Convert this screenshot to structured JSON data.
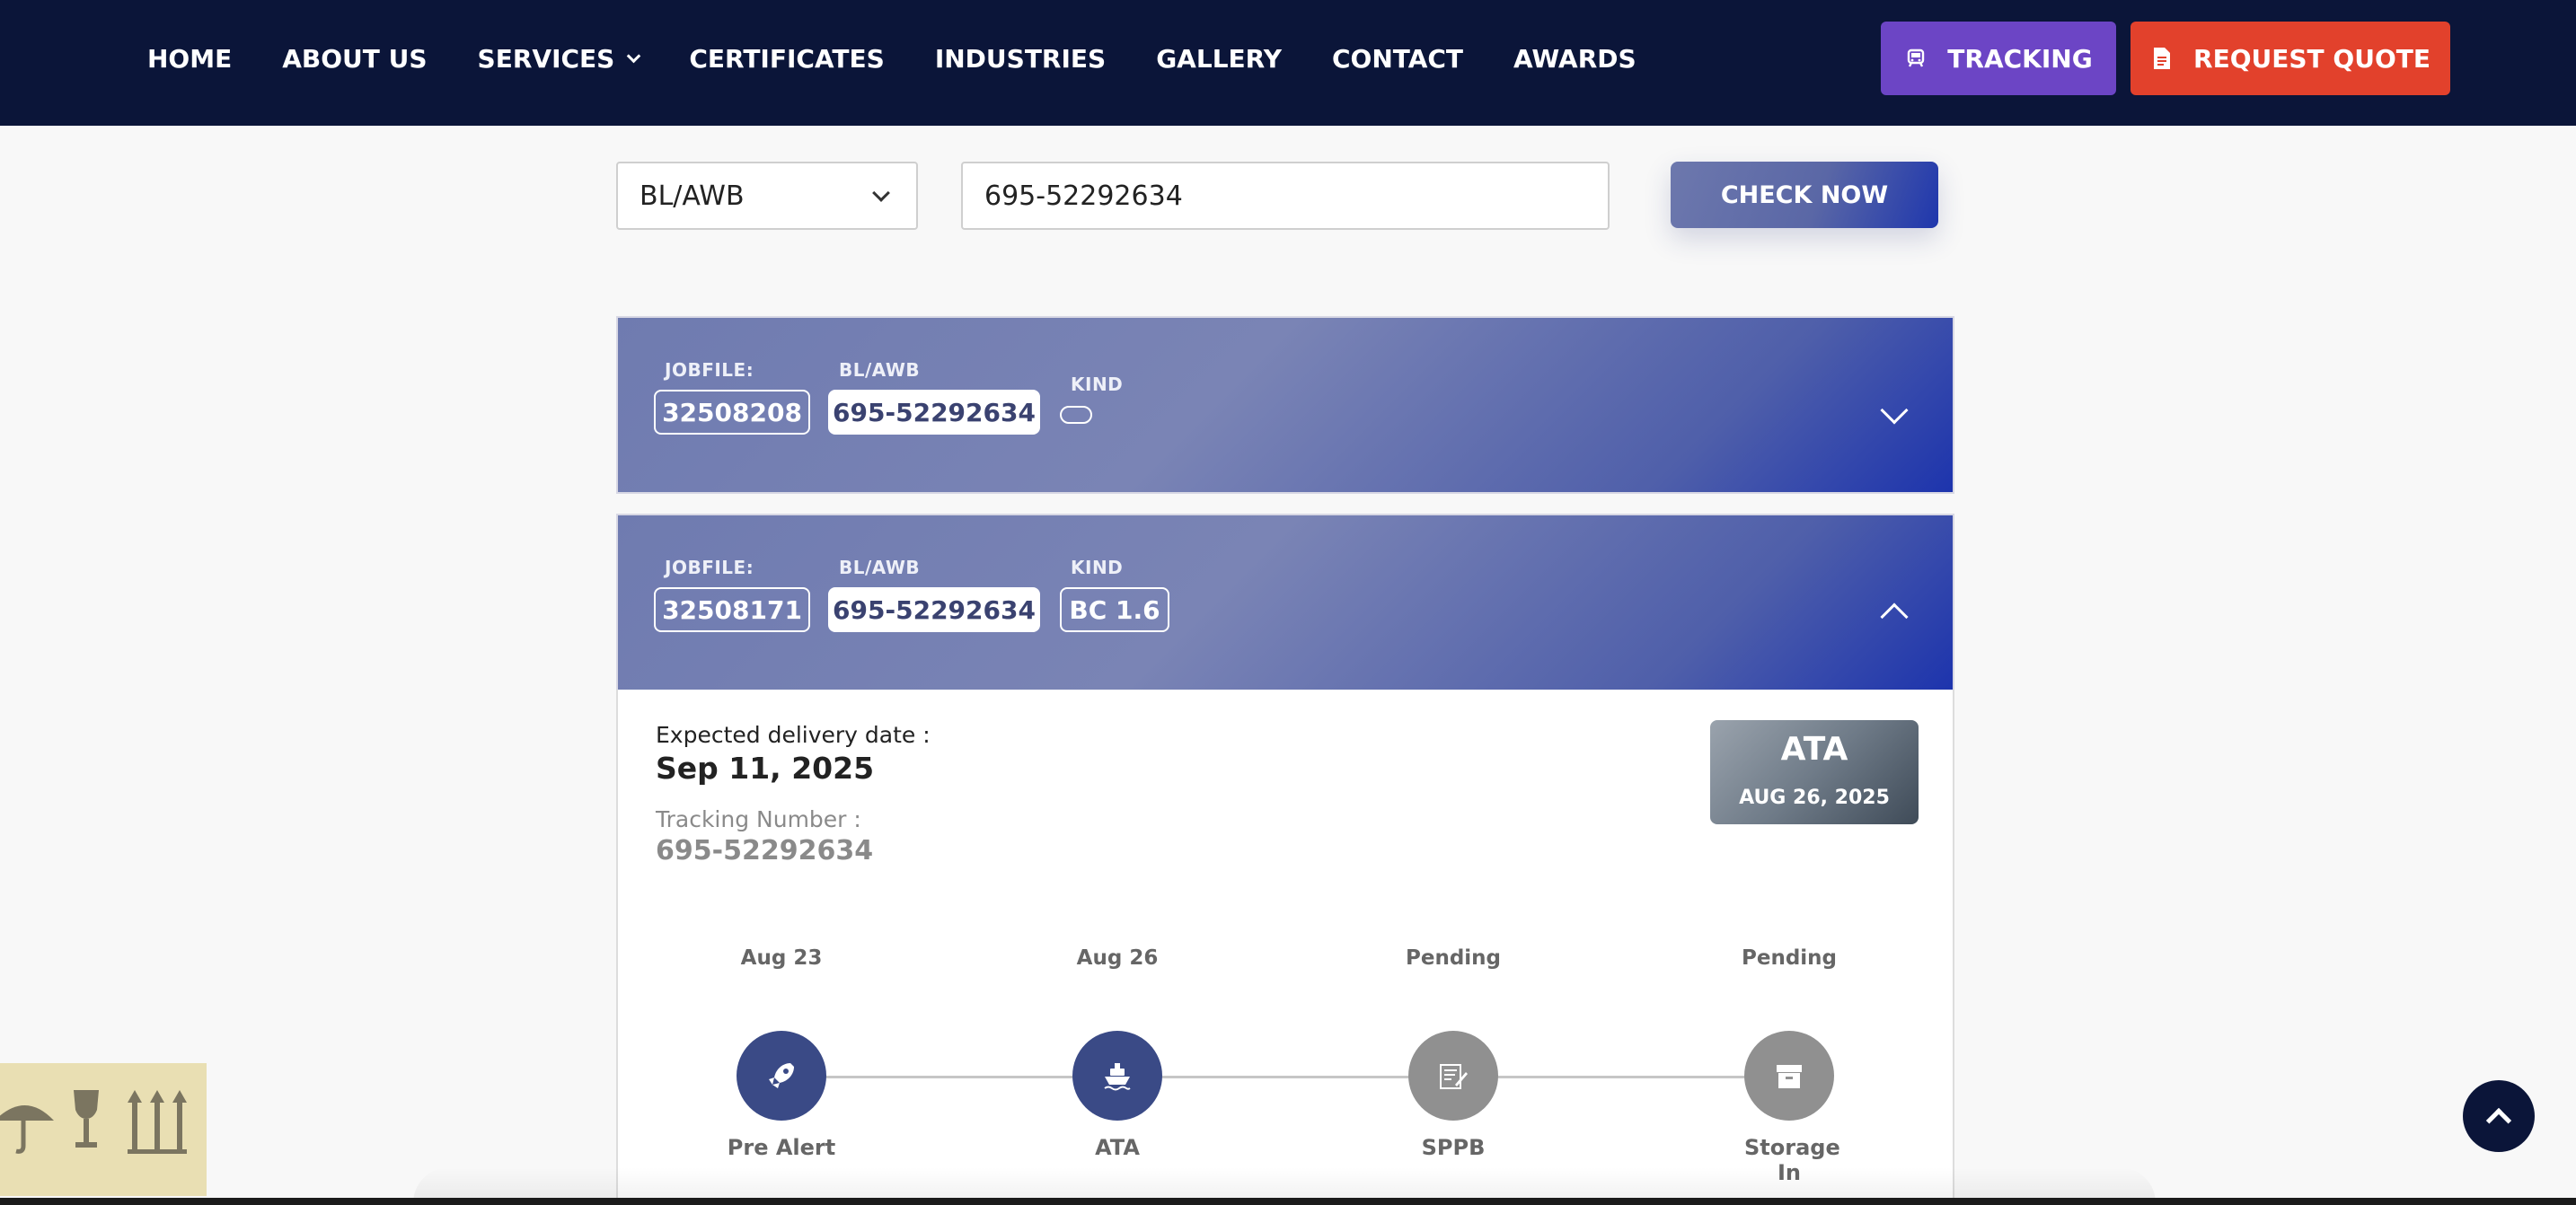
{
  "nav": {
    "links": [
      "HOME",
      "ABOUT US",
      "SERVICES",
      "CERTIFICATES",
      "INDUSTRIES",
      "GALLERY",
      "CONTACT",
      "AWARDS"
    ],
    "tracking_label": "TRACKING",
    "quote_label": "REQUEST QUOTE"
  },
  "search": {
    "type_value": "BL/AWB",
    "number_value": "695-52292634",
    "button_label": "CHECK NOW"
  },
  "results": [
    {
      "jobfile_label": "JOBFILE:",
      "jobfile": "32508208",
      "blawb_label": "BL/AWB",
      "blawb": "695-52292634",
      "kind_label": "KIND",
      "kind": "",
      "expanded": false
    },
    {
      "jobfile_label": "JOBFILE:",
      "jobfile": "32508171",
      "blawb_label": "BL/AWB",
      "blawb": "695-52292634",
      "kind_label": "KIND",
      "kind": "BC 1.6",
      "expanded": true
    }
  ],
  "detail": {
    "expected_label": "Expected delivery date :",
    "expected_value": "Sep 11, 2025",
    "tracking_label": "Tracking Number :",
    "tracking_value": "695-52292634",
    "status_title": "ATA",
    "status_date": "AUG 26, 2025",
    "steps": [
      {
        "date": "Aug 23",
        "label": "Pre Alert",
        "state": "done",
        "icon": "rocket-icon"
      },
      {
        "date": "Aug 26",
        "label": "ATA",
        "state": "done",
        "icon": "ship-icon"
      },
      {
        "date": "Pending",
        "label": "SPPB",
        "state": "pending",
        "icon": "document-sign-icon"
      },
      {
        "date": "Pending",
        "label": "Storage In",
        "state": "pending",
        "icon": "archive-box-icon"
      }
    ]
  },
  "colors": {
    "nav_bg": "#0b1539",
    "tracking_btn": "#6c45c5",
    "quote_btn": "#e2412c",
    "step_done": "#3a4a86",
    "step_pending": "#909090"
  }
}
